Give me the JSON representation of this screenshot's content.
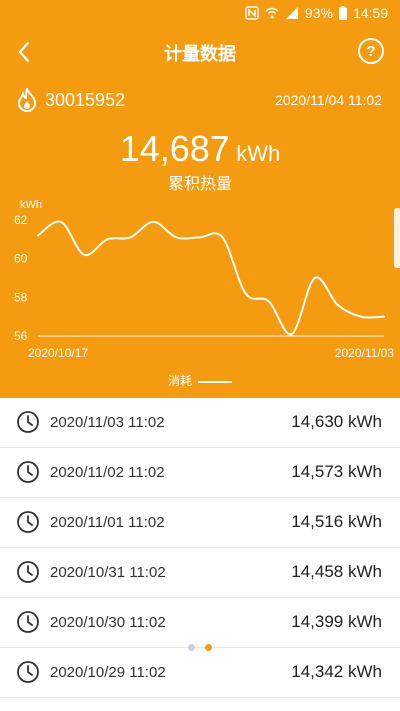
{
  "status_bar": {
    "battery": "93%",
    "time": "14:59",
    "icons": [
      "nfc-icon",
      "wifi-icon",
      "signal-icon",
      "battery-icon"
    ]
  },
  "nav": {
    "title": "计量数据",
    "help_label": "?"
  },
  "meter": {
    "id": "30015952",
    "timestamp": "2020/11/04 11:02"
  },
  "total": {
    "value": "14,687",
    "unit": "kWh",
    "label": "累积热量"
  },
  "chart_data": {
    "type": "line",
    "ylabel": "kWh",
    "ylim": [
      56,
      62
    ],
    "yticks": [
      "62",
      "60",
      "58",
      "56"
    ],
    "x_start_label": "2020/10/17",
    "x_end_label": "2020/11/03",
    "grid": false,
    "legend": "bottom-center",
    "series": [
      {
        "name": "消耗",
        "values": [
          61.2,
          61.9,
          60.2,
          61.0,
          61.1,
          61.9,
          61.1,
          61.1,
          61.1,
          58.2,
          57.8,
          56.1,
          59.0,
          57.6,
          57.0,
          57.0
        ]
      }
    ],
    "line_color": "#ffffff"
  },
  "legend_label": "消耗",
  "records": [
    {
      "time": "2020/11/03 11:02",
      "value": "14,630 kWh"
    },
    {
      "time": "2020/11/02 11:02",
      "value": "14,573 kWh"
    },
    {
      "time": "2020/11/01 11:02",
      "value": "14,516 kWh"
    },
    {
      "time": "2020/10/31 11:02",
      "value": "14,458 kWh"
    },
    {
      "time": "2020/10/30 11:02",
      "value": "14,399 kWh"
    },
    {
      "time": "2020/10/29 11:02",
      "value": "14,342 kWh"
    }
  ],
  "pager": {
    "pages": 2,
    "active": 1
  },
  "colors": {
    "accent": "#f49b10",
    "dot_inactive": "#c8d0d8",
    "dot_active": "#f49b10"
  }
}
